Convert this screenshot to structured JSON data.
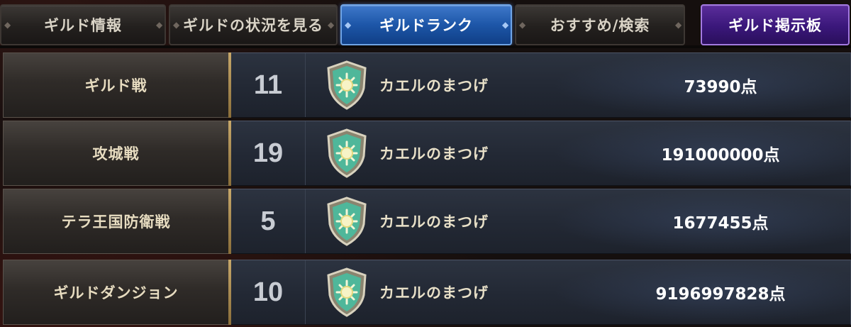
{
  "tabs": [
    {
      "label": "ギルド情報",
      "state": "normal"
    },
    {
      "label": "ギルドの状況を見る",
      "state": "normal"
    },
    {
      "label": "ギルドランク",
      "state": "active"
    },
    {
      "label": "おすすめ/検索",
      "state": "normal"
    },
    {
      "label": "ギルド掲示板",
      "state": "purple"
    }
  ],
  "rankings": [
    {
      "category": "ギルド戦",
      "rank": "11",
      "guild_name": "カエルのまつげ",
      "score": "73990点",
      "emblem": "sun-shield-icon"
    },
    {
      "category": "攻城戦",
      "rank": "19",
      "guild_name": "カエルのまつげ",
      "score": "191000000点",
      "emblem": "sun-shield-icon"
    },
    {
      "category": "テラ王国防衛戦",
      "rank": "5",
      "guild_name": "カエルのまつげ",
      "score": "1677455点",
      "emblem": "sun-shield-icon"
    },
    {
      "category": "ギルドダンジョン",
      "rank": "10",
      "guild_name": "カエルのまつげ",
      "score": "9196997828点",
      "emblem": "sun-shield-icon"
    }
  ],
  "colors": {
    "active_tab": "#1d56a8",
    "board_tab": "#3a177a",
    "emblem_fill": "#4fb79a",
    "emblem_rim": "#c9c2ae",
    "divider_gold": "#c7a86a"
  }
}
